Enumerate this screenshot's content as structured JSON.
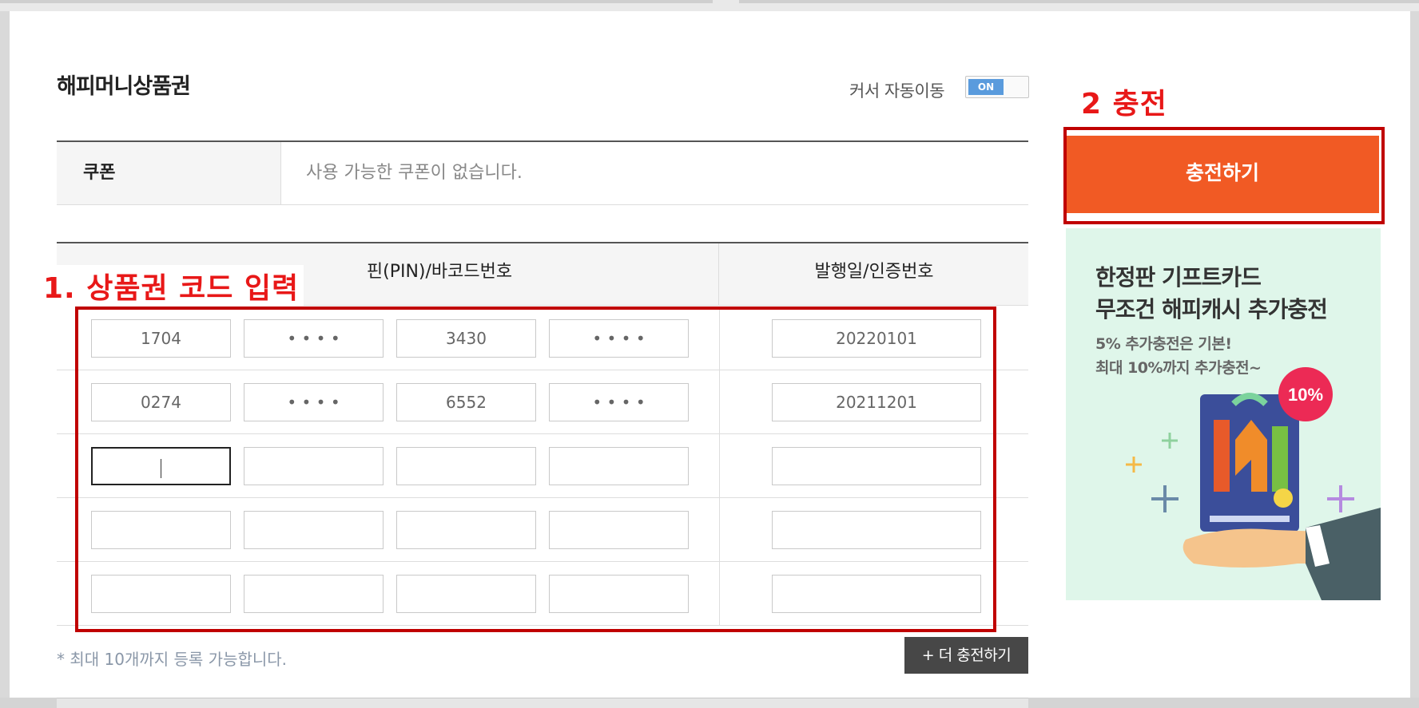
{
  "title": "해피머니상품권",
  "auto_cursor": {
    "label": "커서 자동이동",
    "state": "ON"
  },
  "coupon": {
    "label": "쿠폰",
    "value": "사용 가능한 쿠폰이 없습니다."
  },
  "table": {
    "header_pin": "핀(PIN)/바코드번호",
    "header_date": "발행일/인증번호",
    "rows": [
      {
        "p1": "1704",
        "p2": "• • • •",
        "p3": "3430",
        "p4": "• • • •",
        "date": "20220101"
      },
      {
        "p1": "0274",
        "p2": "• • • •",
        "p3": "6552",
        "p4": "• • • •",
        "date": "20211201"
      },
      {
        "p1": "",
        "p2": "",
        "p3": "",
        "p4": "",
        "date": ""
      },
      {
        "p1": "",
        "p2": "",
        "p3": "",
        "p4": "",
        "date": ""
      },
      {
        "p1": "",
        "p2": "",
        "p3": "",
        "p4": "",
        "date": ""
      }
    ]
  },
  "note": "* 최대 10개까지 등록 가능합니다.",
  "more_button": "+ 더 충전하기",
  "charge_button": "충전하기",
  "banner": {
    "headline_line1": "한정판 기프트카드",
    "headline_line2": "무조건 해피캐시 추가충전",
    "sub_line1": "5% 추가충전은 기본!",
    "sub_line2": "최대 10%까지 추가충전~",
    "badge": "10%",
    "accent_color": "#f15a24",
    "background_color": "#dff6ea"
  },
  "annotations": {
    "step1": "1. 상품권 코드 입력",
    "step2": "2 충전",
    "color": "#c00000"
  }
}
